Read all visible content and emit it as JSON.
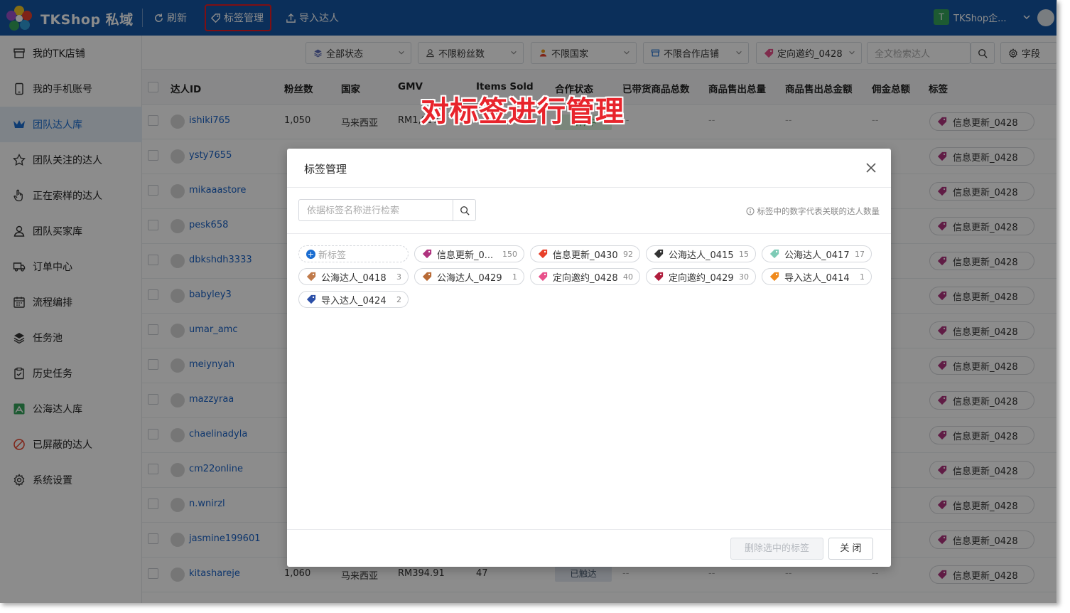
{
  "app": {
    "title": "TKShop 私域",
    "toolbar": {
      "refresh": "刷新",
      "tag_manage": "标签管理",
      "import": "导入达人"
    },
    "account": {
      "initial": "T",
      "name": "TKShop企..."
    }
  },
  "sidebar": {
    "items": [
      {
        "label": "我的TK店铺",
        "icon": "store-icon"
      },
      {
        "label": "我的手机账号",
        "icon": "phone-icon"
      },
      {
        "label": "团队达人库",
        "icon": "creator-library-icon",
        "active": true
      },
      {
        "label": "团队关注的达人",
        "icon": "star-icon"
      },
      {
        "label": "正在索样的达人",
        "icon": "hand-icon"
      },
      {
        "label": "团队买家库",
        "icon": "user-icon"
      },
      {
        "label": "订单中心",
        "icon": "truck-icon"
      },
      {
        "label": "流程编排",
        "icon": "calendar-icon"
      },
      {
        "label": "任务池",
        "icon": "layers-icon"
      },
      {
        "label": "历史任务",
        "icon": "clipboard-icon"
      },
      {
        "label": "公海达人库",
        "icon": "pool-icon"
      },
      {
        "label": "已屏蔽的达人",
        "icon": "block-icon"
      },
      {
        "label": "系统设置",
        "icon": "gear-icon"
      }
    ]
  },
  "filters": {
    "status": "全部状态",
    "fans": "不限粉丝数",
    "country": "不限国家",
    "shop": "不限合作店铺",
    "tag": "定向邀约_0428",
    "search_placeholder": "全文检索达人",
    "fields": "字段"
  },
  "table": {
    "columns": [
      "达人ID",
      "粉丝数",
      "国家",
      "GMV",
      "Items Sold",
      "合作状态",
      "已带货商品总数",
      "商品售出总量",
      "商品售出总金额",
      "佣金总额",
      "标签"
    ],
    "rows": [
      {
        "id": "ishiki765",
        "fans": "1,050",
        "country": "马来西亚",
        "gmv": "RM1,000",
        "items": "",
        "status": "合作中",
        "tag": "信息更新_0428"
      },
      {
        "id": "ysty7655",
        "tag": "信息更新_0428"
      },
      {
        "id": "mikaaastore",
        "tag": "信息更新_0428"
      },
      {
        "id": "pesk658",
        "tag": "信息更新_0428"
      },
      {
        "id": "dbkshdh3333",
        "tag": "信息更新_0428"
      },
      {
        "id": "babyley3",
        "tag": "信息更新_0428"
      },
      {
        "id": "umar_amc",
        "tag": "信息更新_0428"
      },
      {
        "id": "meiynyah",
        "tag": "信息更新_0428"
      },
      {
        "id": "mazzyraa",
        "tag": "信息更新_0428"
      },
      {
        "id": "chaelinadyla",
        "tag": "信息更新_0428"
      },
      {
        "id": "cm22online",
        "tag": "信息更新_0428"
      },
      {
        "id": "n.wnirzl",
        "tag": "信息更新_0428"
      },
      {
        "id": "jasmine199601",
        "tag": "信息更新_0428"
      },
      {
        "id": "kitashareje",
        "fans": "1,060",
        "country": "马来西亚",
        "gmv": "RM394.91",
        "items": "47",
        "status": "已触达",
        "tag": "信息更新_0428"
      }
    ],
    "dash": "--"
  },
  "annotation": "对标签进行管理",
  "modal": {
    "title": "标签管理",
    "search_placeholder": "依据标签名称进行检索",
    "hint": "标签中的数字代表关联的达人数量",
    "new_tag": "新标签",
    "tags": [
      {
        "label": "信息更新_0...",
        "count": "150",
        "color": "#b0337f"
      },
      {
        "label": "信息更新_0430",
        "count": "92",
        "color": "#e8402a"
      },
      {
        "label": "公海达人_0415",
        "count": "15",
        "color": "#333333"
      },
      {
        "label": "公海达人_0417",
        "count": "17",
        "color": "#7ecbb6"
      },
      {
        "label": "公海达人_0418",
        "count": "3",
        "color": "#c07a4a"
      },
      {
        "label": "公海达人_0429",
        "count": "1",
        "color": "#b86a35"
      },
      {
        "label": "定向邀约_0428",
        "count": "40",
        "color": "#e8508a"
      },
      {
        "label": "定向邀约_0429",
        "count": "30",
        "color": "#b01c3c"
      },
      {
        "label": "导入达人_0414",
        "count": "1",
        "color": "#f08a1c"
      },
      {
        "label": "导入达人_0424",
        "count": "2",
        "color": "#2b4fa8"
      }
    ],
    "delete_button": "删除选中的标签",
    "close_button": "关 闭"
  }
}
